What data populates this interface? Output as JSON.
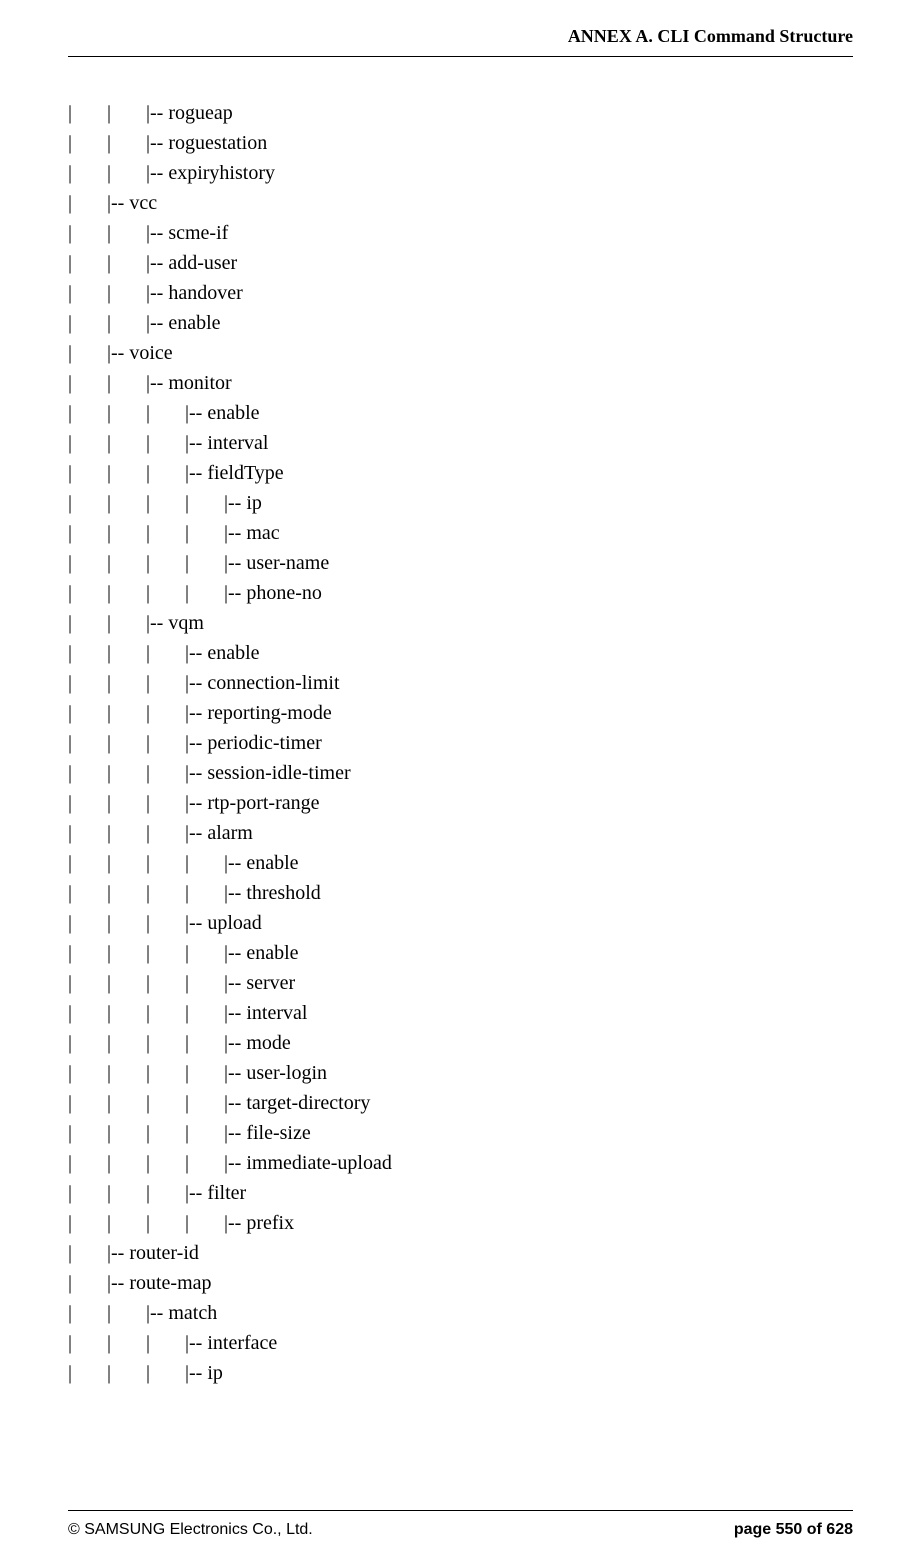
{
  "header": {
    "title": "ANNEX A. CLI Command Structure"
  },
  "footer": {
    "copyright": "© SAMSUNG Electronics Co., Ltd.",
    "page": "page 550 of 628"
  },
  "tree": {
    "lines": [
      "|       |       |-- rogueap",
      "|       |       |-- roguestation",
      "|       |       |-- expiryhistory",
      "|       |-- vcc",
      "|       |       |-- scme-if",
      "|       |       |-- add-user",
      "|       |       |-- handover",
      "|       |       |-- enable",
      "|       |-- voice",
      "|       |       |-- monitor",
      "|       |       |       |-- enable",
      "|       |       |       |-- interval",
      "|       |       |       |-- fieldType",
      "|       |       |       |       |-- ip",
      "|       |       |       |       |-- mac",
      "|       |       |       |       |-- user-name",
      "|       |       |       |       |-- phone-no",
      "|       |       |-- vqm",
      "|       |       |       |-- enable",
      "|       |       |       |-- connection-limit",
      "|       |       |       |-- reporting-mode",
      "|       |       |       |-- periodic-timer",
      "|       |       |       |-- session-idle-timer",
      "|       |       |       |-- rtp-port-range",
      "|       |       |       |-- alarm",
      "|       |       |       |       |-- enable",
      "|       |       |       |       |-- threshold",
      "|       |       |       |-- upload",
      "|       |       |       |       |-- enable",
      "|       |       |       |       |-- server",
      "|       |       |       |       |-- interval",
      "|       |       |       |       |-- mode",
      "|       |       |       |       |-- user-login",
      "|       |       |       |       |-- target-directory",
      "|       |       |       |       |-- file-size",
      "|       |       |       |       |-- immediate-upload",
      "|       |       |       |-- filter",
      "|       |       |       |       |-- prefix",
      "|       |-- router-id",
      "|       |-- route-map",
      "|       |       |-- match",
      "|       |       |       |-- interface",
      "|       |       |       |-- ip"
    ]
  }
}
